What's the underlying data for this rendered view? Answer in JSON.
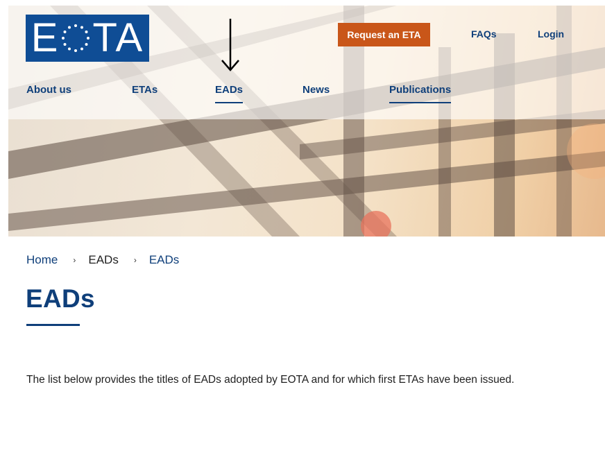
{
  "header": {
    "logo_text_left": "E",
    "logo_text_right": "TA",
    "request_button": "Request an ETA",
    "faqs_link": "FAQs",
    "login_link": "Login",
    "nav": [
      {
        "label": "About us",
        "active": false
      },
      {
        "label": "ETAs",
        "active": false
      },
      {
        "label": "EADs",
        "active": true
      },
      {
        "label": "News",
        "active": false
      },
      {
        "label": "Publications",
        "active": true
      }
    ]
  },
  "annotation": {
    "icon": "down-arrow-icon"
  },
  "breadcrumb": {
    "items": [
      "Home",
      "EADs",
      "EADs"
    ]
  },
  "page": {
    "title": "EADs",
    "intro": "The list below provides the titles of EADs adopted by EOTA and for which first ETAs have been issued."
  },
  "colors": {
    "brand_blue": "#0f4d95",
    "link_blue": "#0f3f7a",
    "accent_orange": "#c95619"
  }
}
